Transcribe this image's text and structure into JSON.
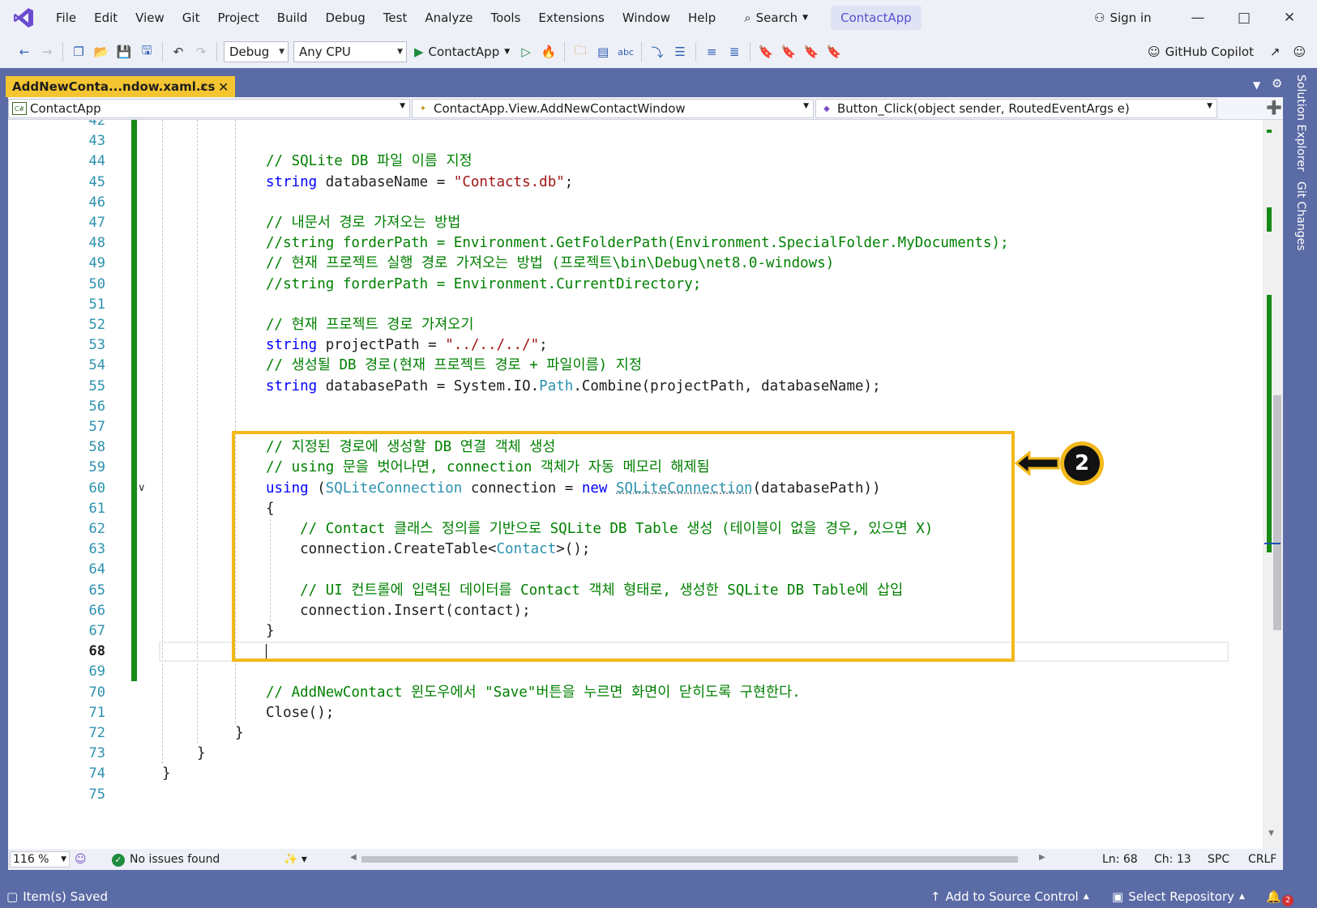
{
  "menu": {
    "items": [
      "File",
      "Edit",
      "View",
      "Git",
      "Project",
      "Build",
      "Debug",
      "Test",
      "Analyze",
      "Tools",
      "Extensions",
      "Window",
      "Help"
    ],
    "search_label": "Search",
    "project_title": "ContactApp",
    "sign_in": "Sign in"
  },
  "toolbar": {
    "configuration": "Debug",
    "platform": "Any CPU",
    "run_target": "ContactApp",
    "copilot_label": "GitHub Copilot"
  },
  "document_tab": {
    "title": "AddNewConta...ndow.xaml.cs"
  },
  "navigation_bar": {
    "project": "ContactApp",
    "type": "ContactApp.View.AddNewContactWindow",
    "member": "Button_Click(object sender, RoutedEventArgs e)"
  },
  "side_tabs": [
    "Solution Explorer",
    "Git Changes"
  ],
  "editor": {
    "first_line": 42,
    "current_line": 68,
    "lines": [
      {
        "num": "42",
        "tokens": []
      },
      {
        "num": "43",
        "tokens": []
      },
      {
        "num": "44",
        "tokens": [
          {
            "t": "// SQLite DB 파일 이름 지정",
            "c": "cm"
          }
        ]
      },
      {
        "num": "45",
        "tokens": [
          {
            "t": "string",
            "c": "kw"
          },
          {
            "t": " databaseName = ",
            "c": ""
          },
          {
            "t": "\"Contacts.db\"",
            "c": "str"
          },
          {
            "t": ";",
            "c": ""
          }
        ]
      },
      {
        "num": "46",
        "tokens": []
      },
      {
        "num": "47",
        "tokens": [
          {
            "t": "// 내문서 경로 가져오는 방법",
            "c": "cm"
          }
        ]
      },
      {
        "num": "48",
        "tokens": [
          {
            "t": "//string forderPath = Environment.GetFolderPath(Environment.SpecialFolder.MyDocuments);",
            "c": "cm"
          }
        ]
      },
      {
        "num": "49",
        "tokens": [
          {
            "t": "// 현재 프로젝트 실행 경로 가져오는 방법 (프로젝트\\bin\\Debug\\net8.0-windows)",
            "c": "cm"
          }
        ]
      },
      {
        "num": "50",
        "tokens": [
          {
            "t": "//string forderPath = Environment.CurrentDirectory;",
            "c": "cm"
          }
        ]
      },
      {
        "num": "51",
        "tokens": []
      },
      {
        "num": "52",
        "tokens": [
          {
            "t": "// 현재 프로젝트 경로 가져오기",
            "c": "cm"
          }
        ]
      },
      {
        "num": "53",
        "tokens": [
          {
            "t": "string",
            "c": "kw"
          },
          {
            "t": " projectPath = ",
            "c": ""
          },
          {
            "t": "\"../../../\"",
            "c": "str"
          },
          {
            "t": ";",
            "c": ""
          }
        ]
      },
      {
        "num": "54",
        "tokens": [
          {
            "t": "// 생성될 DB 경로(현재 프로젝트 경로 + 파일이름) 지정",
            "c": "cm"
          }
        ]
      },
      {
        "num": "55",
        "tokens": [
          {
            "t": "string",
            "c": "kw"
          },
          {
            "t": " databasePath = System.IO.",
            "c": ""
          },
          {
            "t": "Path",
            "c": "ty"
          },
          {
            "t": ".Combine(projectPath, databaseName);",
            "c": ""
          }
        ]
      },
      {
        "num": "56",
        "tokens": []
      },
      {
        "num": "57",
        "tokens": []
      },
      {
        "num": "58",
        "tokens": [
          {
            "t": "// 지정된 경로에 생성할 DB 연결 객체 생성",
            "c": "cm"
          }
        ]
      },
      {
        "num": "59",
        "tokens": [
          {
            "t": "// using 문을 벗어나면, connection 객체가 자동 메모리 해제됨",
            "c": "cm"
          }
        ]
      },
      {
        "num": "60",
        "tokens": [
          {
            "t": "using",
            "c": "kw"
          },
          {
            "t": " (",
            "c": ""
          },
          {
            "t": "SQLiteConnection",
            "c": "ty"
          },
          {
            "t": " connection = ",
            "c": ""
          },
          {
            "t": "new",
            "c": "kw"
          },
          {
            "t": " ",
            "c": ""
          },
          {
            "t": "SQLiteConnection",
            "c": "ty squig"
          },
          {
            "t": "(databasePath))",
            "c": ""
          }
        ]
      },
      {
        "num": "61",
        "tokens": [
          {
            "t": "{",
            "c": ""
          }
        ]
      },
      {
        "num": "62",
        "tokens": [
          {
            "t": "    // Contact 클래스 정의를 기반으로 SQLite DB Table 생성 (테이블이 없을 경우, 있으면 X)",
            "c": "cm"
          }
        ]
      },
      {
        "num": "63",
        "tokens": [
          {
            "t": "    connection.CreateTable<",
            "c": ""
          },
          {
            "t": "Contact",
            "c": "ty"
          },
          {
            "t": ">();",
            "c": ""
          }
        ]
      },
      {
        "num": "64",
        "tokens": []
      },
      {
        "num": "65",
        "tokens": [
          {
            "t": "    // UI 컨트롤에 입력된 데이터를 Contact 객체 형태로, 생성한 SQLite DB Table에 삽입",
            "c": "cm"
          }
        ]
      },
      {
        "num": "66",
        "tokens": [
          {
            "t": "    connection.Insert(contact);",
            "c": ""
          }
        ]
      },
      {
        "num": "67",
        "tokens": [
          {
            "t": "}",
            "c": ""
          }
        ]
      },
      {
        "num": "68",
        "tokens": []
      },
      {
        "num": "69",
        "tokens": []
      },
      {
        "num": "70",
        "tokens": [
          {
            "t": "// AddNewContact 윈도우에서 ",
            "c": "cm"
          },
          {
            "t": "\"Save\"",
            "c": "cm"
          },
          {
            "t": "버튼을 누르면 화면이 닫히도록 구현한다.",
            "c": "cm"
          }
        ]
      },
      {
        "num": "71",
        "tokens": [
          {
            "t": "Close();",
            "c": ""
          }
        ]
      },
      {
        "num": "72",
        "tokens": [
          {
            "t": "}",
            "c": "",
            "indent": -1
          }
        ]
      },
      {
        "num": "73",
        "tokens": [
          {
            "t": "}",
            "c": "",
            "indent": -2
          }
        ]
      },
      {
        "num": "74",
        "tokens": [
          {
            "t": "}",
            "c": "",
            "indent": -3
          }
        ]
      },
      {
        "num": "75",
        "tokens": []
      }
    ],
    "callout_number": "2"
  },
  "editor_status": {
    "zoom": "116 %",
    "issues": "No issues found",
    "line": "Ln: 68",
    "char": "Ch: 13",
    "whitespace": "SPC",
    "line_ending": "CRLF"
  },
  "statusbar": {
    "message": "Item(s) Saved",
    "source_control": "Add to Source Control",
    "repository": "Select Repository",
    "notification_count": "2"
  },
  "colors": {
    "accent": "#5b6ba6",
    "tab_active": "#f5c531",
    "highlight": "#f3b81a",
    "keyword": "#0000ff",
    "type": "#2b91af",
    "string": "#a31515",
    "comment": "#008000",
    "change_bar": "#178a17"
  }
}
